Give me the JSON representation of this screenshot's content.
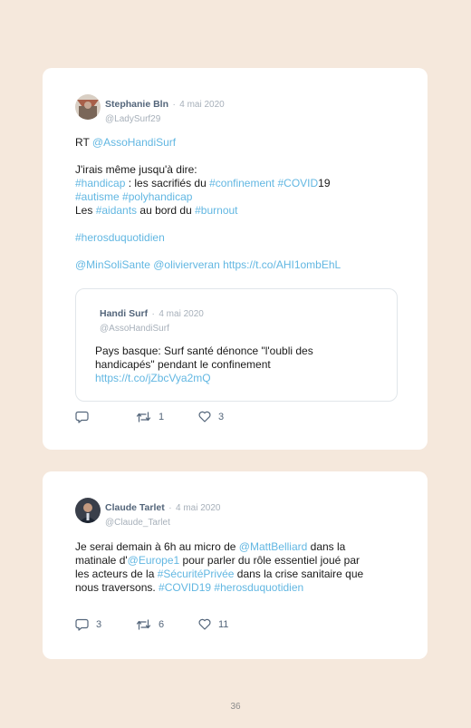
{
  "tweets": [
    {
      "author": "Stephanie Bln",
      "separator": "·",
      "date": "4 mai 2020",
      "handle": "@LadySurf29",
      "body": {
        "l1": {
          "a": "RT ",
          "b": "@AssoHandiSurf"
        },
        "l2": "J'irais même jusqu'à dire:",
        "l3": {
          "a": "#handicap",
          "b": " : les sacrifiés du ",
          "c": "#confinement",
          "d": " ",
          "e": "#COVID",
          "f": "19"
        },
        "l4": {
          "a": "#autisme",
          "b": " ",
          "c": "#polyhandicap"
        },
        "l5": {
          "a": "Les ",
          "b": "#aidants",
          "c": " au bord du ",
          "d": "#burnout"
        },
        "l6": "#herosduquotidien",
        "l7": {
          "a": "@MinSoliSante",
          "b": " ",
          "c": "@olivierveran",
          "d": " ",
          "e": "https://t.co/AHI1ombEhL"
        }
      },
      "quote": {
        "author": "Handi Surf",
        "separator": "·",
        "date": "4 mai 2020",
        "handle": "@AssoHandiSurf",
        "l1": "Pays basque: Surf santé dénonce \"l'oubli des",
        "l2": "handicapés\" pendant le confinement",
        "l3": "https://t.co/jZbcVya2mQ"
      },
      "actions": {
        "replies": "",
        "retweets": "1",
        "likes": "3"
      }
    },
    {
      "author": "Claude Tarlet",
      "separator": "·",
      "date": "4 mai 2020",
      "handle": "@Claude_Tarlet",
      "body": {
        "l1": {
          "a": "Je serai demain à 6h au micro de ",
          "b": "@MattBelliard",
          "c": " dans la"
        },
        "l2": {
          "a": "matinale d'",
          "b": "@Europe1",
          "c": " pour parler du rôle essentiel joué par"
        },
        "l3": {
          "a": "les acteurs de la ",
          "b": "#SécuritéPrivée",
          "c": " dans la crise sanitaire que"
        },
        "l4": {
          "a": "nous traversons. ",
          "b": "#COVID19",
          "c": " ",
          "d": "#herosduquotidien"
        }
      },
      "actions": {
        "replies": "3",
        "retweets": "6",
        "likes": "11"
      }
    }
  ],
  "page_number": "36",
  "icons": [
    "reply-icon",
    "retweet-icon",
    "like-icon"
  ],
  "colors": {
    "link": "#62b7e2",
    "background": "#f5e8dc",
    "name": "#53657a",
    "muted": "#a7b0ba"
  }
}
